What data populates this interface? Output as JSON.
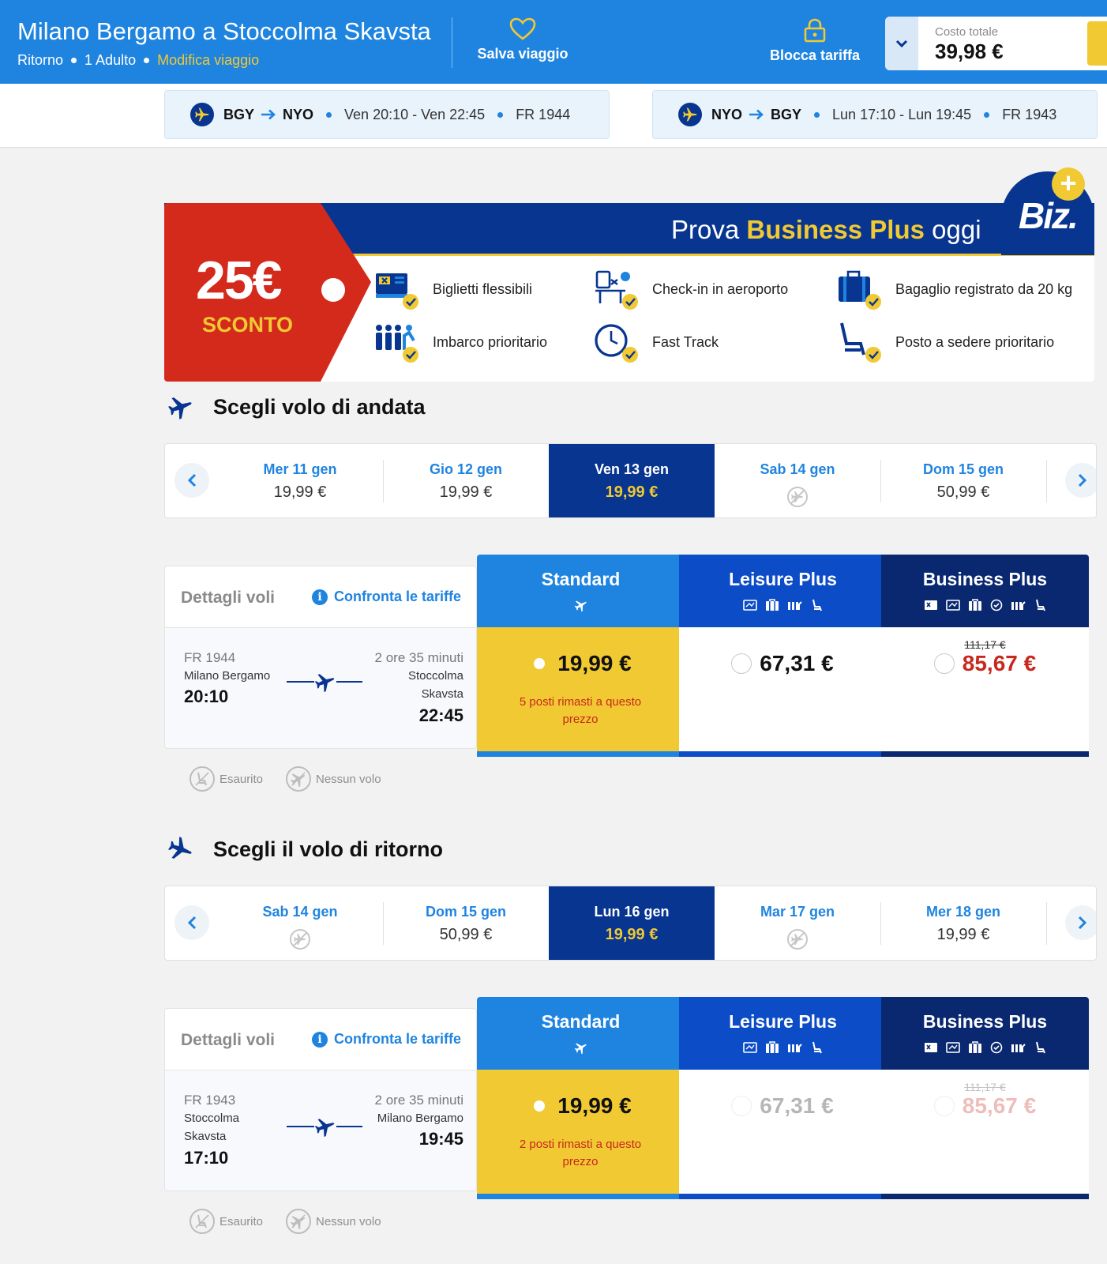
{
  "header": {
    "title": "Milano Bergamo a Stoccolma Skavsta",
    "trip_type": "Ritorno",
    "passengers": "1 Adulto",
    "edit_link": "Modifica viaggio",
    "save_trip": "Salva viaggio",
    "lock_fare": "Blocca tariffa",
    "total_label": "Costo totale",
    "total_value": "39,98 €"
  },
  "summary": {
    "outbound": {
      "from": "BGY",
      "to": "NYO",
      "times": "Ven 20:10 - Ven 22:45",
      "flight": "FR 1944"
    },
    "return": {
      "from": "NYO",
      "to": "BGY",
      "times": "Lun 17:10 - Lun 19:45",
      "flight": "FR 1943"
    }
  },
  "promo": {
    "title_prefix": "Prova",
    "title_highlight": "Business Plus",
    "title_suffix": "oggi",
    "discount": "25€",
    "discount_label": "SCONTO",
    "brand": "Biz.",
    "perks": [
      "Biglietti flessibili",
      "Check-in in aeroporto",
      "Bagaglio registrato da 20 kg",
      "Imbarco prioritario",
      "Fast Track",
      "Posto a sedere prioritario"
    ]
  },
  "outbound": {
    "title": "Scegli volo di andata",
    "dates": [
      {
        "day": "Mer 11 gen",
        "price": "19,99 €"
      },
      {
        "day": "Gio 12 gen",
        "price": "19,99 €"
      },
      {
        "day": "Ven 13 gen",
        "price": "19,99 €"
      },
      {
        "day": "Sab 14 gen",
        "price": ""
      },
      {
        "day": "Dom 15 gen",
        "price": "50,99 €"
      }
    ],
    "details_label": "Dettagli voli",
    "compare_label": "Confronta le tariffe",
    "flight": {
      "number": "FR 1944",
      "duration": "2 ore 35 minuti",
      "origin": "Milano Bergamo",
      "destination_line1": "Stoccolma",
      "destination_line2": "Skavsta",
      "depart": "20:10",
      "arrive": "22:45"
    },
    "fares": {
      "standard": {
        "name": "Standard",
        "price": "19,99 €",
        "seats": "5 posti rimasti a questo prezzo"
      },
      "leisure": {
        "name": "Leisure Plus",
        "price": "67,31 €"
      },
      "business": {
        "name": "Business Plus",
        "old_price": "111,17 €",
        "price": "85,67 €"
      }
    }
  },
  "return": {
    "title": "Scegli il volo di ritorno",
    "dates": [
      {
        "day": "Sab 14 gen",
        "price": ""
      },
      {
        "day": "Dom 15 gen",
        "price": "50,99 €"
      },
      {
        "day": "Lun 16 gen",
        "price": "19,99 €"
      },
      {
        "day": "Mar 17 gen",
        "price": ""
      },
      {
        "day": "Mer 18 gen",
        "price": "19,99 €"
      }
    ],
    "details_label": "Dettagli voli",
    "compare_label": "Confronta le tariffe",
    "flight": {
      "number": "FR 1943",
      "duration": "2 ore 35 minuti",
      "origin_line1": "Stoccolma",
      "origin_line2": "Skavsta",
      "destination": "Milano Bergamo",
      "depart": "17:10",
      "arrive": "19:45"
    },
    "fares": {
      "standard": {
        "name": "Standard",
        "price": "19,99 €",
        "seats": "2 posti rimasti a questo prezzo"
      },
      "leisure": {
        "name": "Leisure Plus",
        "price": "67,31 €"
      },
      "business": {
        "name": "Business Plus",
        "old_price": "111,17 €",
        "price": "85,67 €"
      }
    }
  },
  "legend": {
    "sold_out": "Esaurito",
    "no_flight": "Nessun volo"
  },
  "colors": {
    "primary_blue": "#1f84e0",
    "leisure_blue": "#0c4cc7",
    "navy": "#073590",
    "business_navy": "#0a2870",
    "yellow": "#f1c933",
    "sale_red": "#c8281d",
    "promo_red": "#d42a1b"
  }
}
